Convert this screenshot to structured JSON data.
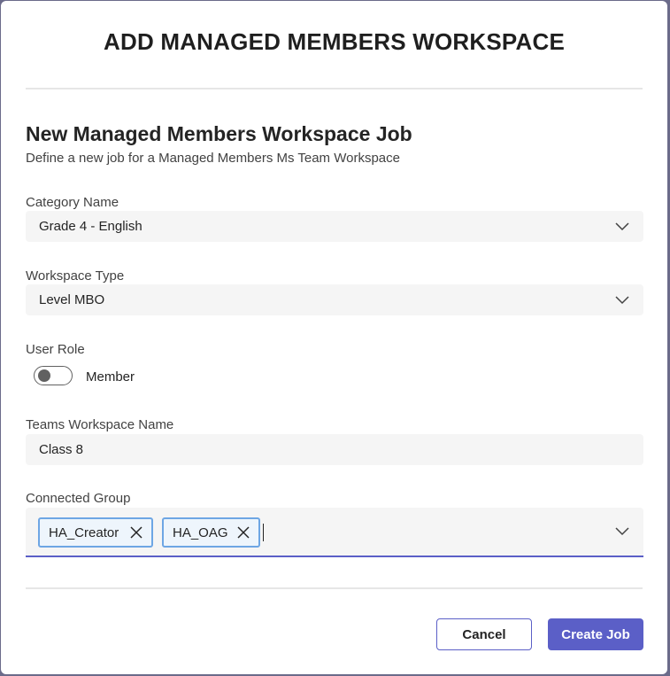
{
  "dialog": {
    "title": "ADD MANAGED MEMBERS WORKSPACE",
    "section_title": "New Managed Members Workspace Job",
    "section_subtitle": "Define a new job for a Managed Members Ms Team Workspace"
  },
  "fields": {
    "category": {
      "label": "Category Name",
      "value": "Grade 4 - English"
    },
    "workspace_type": {
      "label": "Workspace Type",
      "value": "Level MBO"
    },
    "user_role": {
      "label": "User Role",
      "toggle_label": "Member",
      "toggle_on": false
    },
    "workspace_name": {
      "label": "Teams Workspace Name",
      "value": "Class 8"
    },
    "connected_group": {
      "label": "Connected Group",
      "chips": [
        "HA_Creator",
        "HA_OAG"
      ]
    }
  },
  "buttons": {
    "cancel": "Cancel",
    "create": "Create Job"
  },
  "colors": {
    "accent": "#5b5fc7",
    "chip_border": "#6ea6e4",
    "field_bg": "#f5f5f5"
  }
}
